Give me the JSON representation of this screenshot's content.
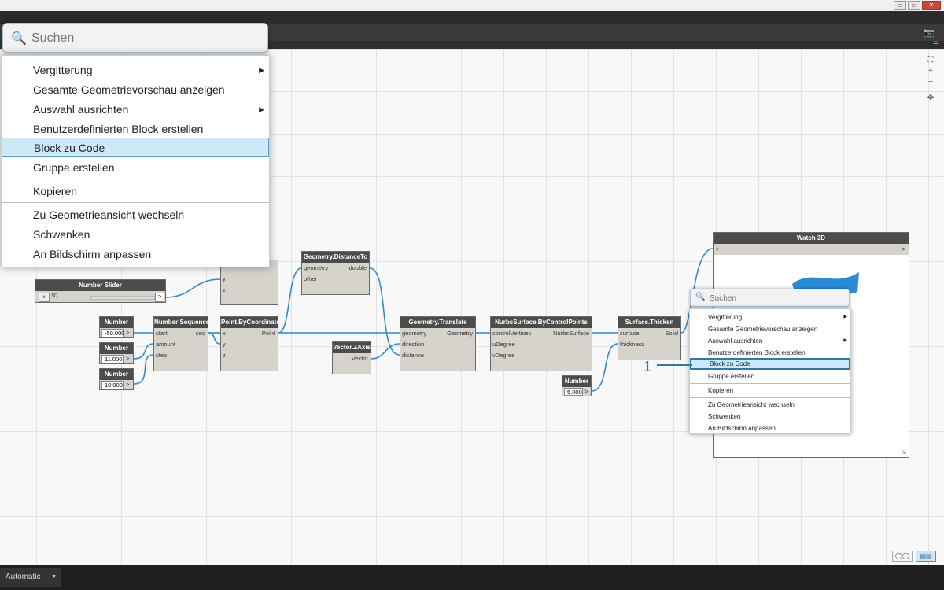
{
  "window": {
    "minimize": "▭",
    "maximize": "▭",
    "close": "✕"
  },
  "nodes": {
    "number_slider": {
      "title": "Number Slider",
      "value": "50",
      "out": ">"
    },
    "number1": {
      "title": "Number",
      "value": "-50.000",
      "out": ">"
    },
    "number2": {
      "title": "Number",
      "value": "11.000",
      "out": ">"
    },
    "number3": {
      "title": "Number",
      "value": "10.000",
      "out": ">"
    },
    "number_sequence": {
      "title": "Number Sequence",
      "inputs": [
        "start",
        "amount",
        "step"
      ],
      "output": "seq"
    },
    "point1": {
      "inputs": [
        "y",
        "z"
      ]
    },
    "point_by_coords": {
      "title": "Point.ByCoordinates",
      "inputs": [
        "x",
        "y",
        "z"
      ],
      "output": "Point"
    },
    "distance_to": {
      "title": "Geometry.DistanceTo",
      "inputs": [
        "geometry",
        "other"
      ],
      "output": "double"
    },
    "vector_zaxis": {
      "title": "Vector.ZAxis",
      "output": "Vector"
    },
    "translate": {
      "title": "Geometry.Translate",
      "inputs": [
        "geometry",
        "direction",
        "distance"
      ],
      "output": "Geometry"
    },
    "nurbs": {
      "title": "NurbsSurface.ByControlPoints",
      "inputs": [
        "controlVertices",
        "uDegree",
        "vDegree"
      ],
      "output": "NurbsSurface"
    },
    "thicken": {
      "title": "Surface.Thicken",
      "inputs": [
        "surface",
        "thickness"
      ],
      "output": "Solid"
    },
    "number4": {
      "title": "Number",
      "value": "5.000",
      "out": ">"
    },
    "watch3d": {
      "title": "Watch 3D",
      "in": ">",
      "out": ">"
    }
  },
  "big_menu": {
    "search_placeholder": "Suchen",
    "items": [
      "Vergitterung",
      "Gesamte Geometrievorschau anzeigen",
      "Auswahl ausrichten",
      "Benutzerdefinierten Block erstellen",
      "Block zu Code",
      "Gruppe erstellen",
      "Kopieren",
      "Zu Geometrieansicht wechseln",
      "Schwenken",
      "An Bildschirm anpassen"
    ],
    "highlighted": "Block zu Code"
  },
  "small_menu": {
    "search_placeholder": "Suchen",
    "items": [
      "Vergitterung",
      "Gesamte Geometrievorschau anzeigen",
      "Auswahl ausrichten",
      "Benutzerdefinierten Block erstellen",
      "Block zu Code",
      "Gruppe erstellen",
      "Kopieren",
      "Zu Geometrieansicht wechseln",
      "Schwenken",
      "An Bildschirm anpassen"
    ],
    "highlighted": "Block zu Code"
  },
  "callout": "1",
  "run_mode": "Automatic",
  "colors": {
    "wire": "#2f8ad0",
    "highlight": "#cde8f6",
    "accent": "#2a7ca8",
    "surface_preview": "#2a8ad8"
  }
}
